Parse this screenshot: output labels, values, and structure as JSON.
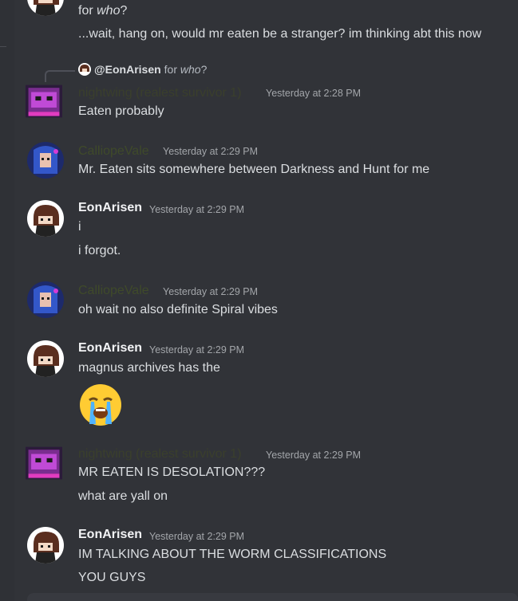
{
  "colors": {
    "background": "#313338",
    "username_default": "#f2f3f5",
    "username_role": "#3f4a2a",
    "timestamp": "#a3a6aa",
    "text": "#dbdee1"
  },
  "messages": [
    {
      "id": "m0",
      "continuation": true,
      "lines": [
        "for who?",
        "...wait, hang on, would mr eaten be a stranger? im thinking abt this now"
      ]
    },
    {
      "id": "m1",
      "reply": {
        "user": "@EonArisen",
        "text": "for who?"
      },
      "username": "nightwing (realest survivor 1)",
      "timestamp": "Yesterday at 2:28 PM",
      "lines": [
        "Eaten probably"
      ]
    },
    {
      "id": "m2",
      "username": "CalliopeVale",
      "timestamp": "Yesterday at 2:29 PM",
      "lines": [
        "Mr. Eaten sits somewhere between Darkness and Hunt for me"
      ]
    },
    {
      "id": "m3",
      "username": "EonArisen",
      "timestamp": "Yesterday at 2:29 PM",
      "lines": [
        "i",
        "i forgot."
      ]
    },
    {
      "id": "m4",
      "username": "CalliopeVale",
      "timestamp": "Yesterday at 2:29 PM",
      "lines": [
        "oh wait no also definite Spiral vibes"
      ]
    },
    {
      "id": "m5",
      "username": "EonArisen",
      "timestamp": "Yesterday at 2:29 PM",
      "lines": [
        "magnus archives has the"
      ],
      "emoji": "loudly-crying-face"
    },
    {
      "id": "m6",
      "username": "nightwing (realest survivor 1)",
      "timestamp": "Yesterday at 2:29 PM",
      "lines": [
        "MR EATEN IS DESOLATION???",
        "what are yall on"
      ]
    },
    {
      "id": "m7",
      "username": "EonArisen",
      "timestamp": "Yesterday at 2:29 PM",
      "lines": [
        "IM TALKING ABOUT THE WORM CLASSIFICATIONS",
        "YOU GUYS"
      ]
    }
  ]
}
